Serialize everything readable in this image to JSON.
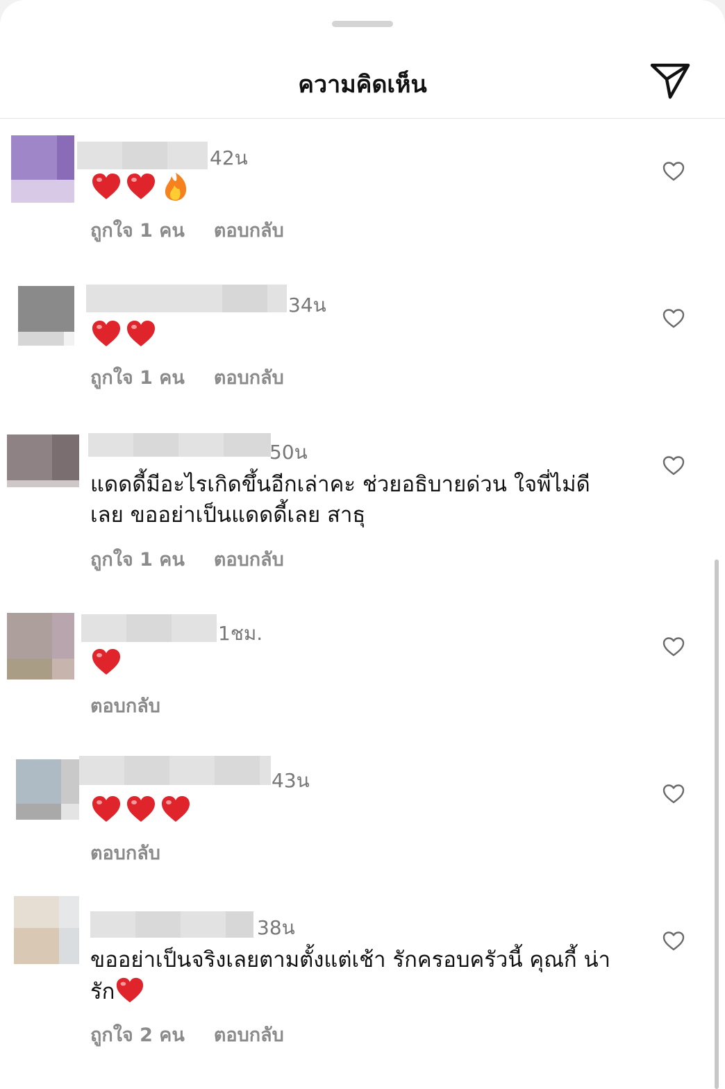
{
  "header": {
    "title": "ความคิดเห็น"
  },
  "comments": [
    {
      "time": "42น",
      "emojis": [
        "red-heart",
        "red-heart",
        "fire"
      ],
      "text": "",
      "likes": "ถูกใจ 1 คน",
      "reply": "ตอบกลับ",
      "avatar_colors": [
        "#9e86c9",
        "#8a6bb8",
        "#d8c9e6"
      ]
    },
    {
      "time": "34น",
      "emojis": [
        "red-heart",
        "red-heart"
      ],
      "text": "",
      "likes": "ถูกใจ 1 คน",
      "reply": "ตอบกลับ",
      "avatar_colors": [
        "#8a8a8a",
        "#7b7b7b",
        "#d6d6d6"
      ]
    },
    {
      "time": "50น",
      "emojis": [],
      "text": "แดดดี้มีอะไรเกิดขึ้นอีกเล่าคะ ช่วยอธิบายด่วน ใจพี่ไม่ดี\nเลย ขออย่าเป็นแดดดี้เลย สาธุ",
      "likes": "ถูกใจ 1 คน",
      "reply": "ตอบกลับ",
      "avatar_colors": [
        "#8f8285",
        "#7a6e70",
        "#cfc7c8"
      ]
    },
    {
      "time": "1ชม.",
      "emojis": [
        "red-heart"
      ],
      "text": "",
      "likes": "",
      "reply": "ตอบกลับ",
      "avatar_colors": [
        "#ad9f9c",
        "#b9a5ad",
        "#a99e85"
      ]
    },
    {
      "time": "43น",
      "emojis": [
        "red-heart",
        "red-heart",
        "red-heart"
      ],
      "text": "",
      "likes": "",
      "reply": "ตอบกลับ",
      "avatar_colors": [
        "#aebac4",
        "#c9c9c9",
        "#a9a9a9"
      ]
    },
    {
      "time": "38น",
      "emojis": [],
      "text": "ขออย่าเป็นจริงเลยตามตั้งแต่เช้า รักครอบครัวนี้ คุณกี้ น่า\nรัก",
      "text_trailing_emoji": "red-heart",
      "likes": "ถูกใจ 2 คน",
      "reply": "ตอบกลับ",
      "avatar_colors": [
        "#e6ddd3",
        "#d8c8b4",
        "#d9dde0"
      ]
    }
  ],
  "icons": {
    "share": "paper-plane-icon",
    "like": "heart-outline-icon"
  },
  "colors": {
    "heart_red": "#e0242b",
    "secondary_text": "#8a8a8a"
  }
}
